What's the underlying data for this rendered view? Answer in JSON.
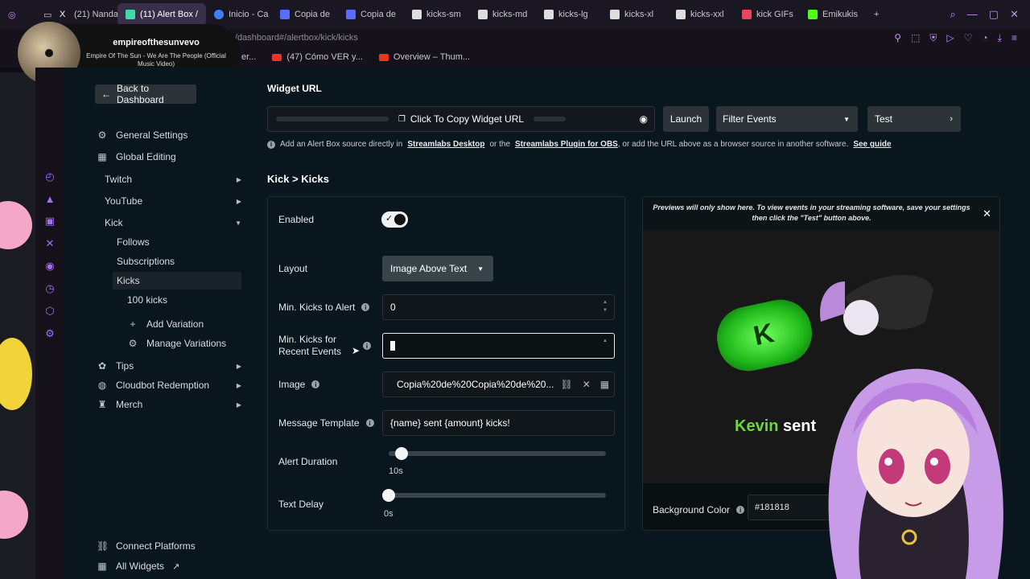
{
  "browser": {
    "tabs": [
      {
        "label": "(21) Nanda",
        "color": "#ffffff"
      },
      {
        "label": "(11) Alert Box /",
        "color": "#40d9a8",
        "active": true
      },
      {
        "label": "Inicio - Ca",
        "color": "#3b82f6"
      },
      {
        "label": "Copia de",
        "color": "#5b6cf5"
      },
      {
        "label": "Copia de",
        "color": "#5b6cf5"
      },
      {
        "label": "kicks-sm",
        "color": "#dddddd"
      },
      {
        "label": "kicks-md",
        "color": "#dddddd"
      },
      {
        "label": "kicks-lg",
        "color": "#dddddd"
      },
      {
        "label": "kicks-xl",
        "color": "#dddddd"
      },
      {
        "label": "kicks-xxl",
        "color": "#dddddd"
      },
      {
        "label": "kick GIFs",
        "color": "#e8475f"
      },
      {
        "label": "Emikukis",
        "color": "#53fc18"
      }
    ],
    "url_fragment": "/dashboard#/alertbox/kick/kicks",
    "bookmarks": [
      "er...",
      "(47) Cómo VER y...",
      "Overview – Thum..."
    ]
  },
  "music": {
    "artist": "empireofthesunvevo",
    "song": "Empire Of The Sun - We Are The People (Official Music Video)"
  },
  "sidebar": {
    "back_label": "Back to Dashboard",
    "general_settings": "General Settings",
    "global_editing": "Global Editing",
    "twitch": "Twitch",
    "youtube": "YouTube",
    "kick": "Kick",
    "follows": "Follows",
    "subscriptions": "Subscriptions",
    "kicks": "Kicks",
    "kicks_100": "100 kicks",
    "add_variation": "Add Variation",
    "manage_variations": "Manage Variations",
    "tips": "Tips",
    "cloudbot": "Cloudbot Redemption",
    "merch": "Merch",
    "connect_platforms": "Connect Platforms",
    "all_widgets": "All Widgets"
  },
  "main": {
    "widget_url_label": "Widget URL",
    "copy_label": "Click To Copy Widget URL",
    "launch": "Launch",
    "filter_events": "Filter Events",
    "test": "Test",
    "info": {
      "prefix": "Add an Alert Box source directly in",
      "desktop": "Streamlabs Desktop",
      "middle": "or the",
      "plugin": "Streamlabs Plugin for OBS",
      "suffix": ", or add the URL above as a browser source in another software.",
      "guide": "See guide"
    },
    "breadcrumb": "Kick > Kicks"
  },
  "settings": {
    "enabled_label": "Enabled",
    "enabled": true,
    "layout_label": "Layout",
    "layout_value": "Image Above Text",
    "min_alert_label": "Min. Kicks to Alert",
    "min_alert_value": "0",
    "min_recent_label_1": "Min. Kicks for",
    "min_recent_label_2": "Recent Events",
    "min_recent_value": "0",
    "image_label": "Image",
    "image_value": "Copia%20de%20Copia%20de%20...",
    "template_label": "Message Template",
    "template_value": "{name} sent {amount} kicks!",
    "duration_label": "Alert Duration",
    "duration_value": "10s",
    "duration_fraction": 0.03,
    "delay_label": "Text Delay",
    "delay_value": "0s",
    "delay_fraction": 0.0
  },
  "preview": {
    "note": "Previews will only show here. To view events in your streaming software, save your settings then click the \"Test\" button above.",
    "name": "Kevin",
    "text": " sent",
    "bg_label": "Background Color",
    "bg_value": "#181818"
  },
  "colors": {
    "accent_green": "#53fc18",
    "panel_bg": "#09161d",
    "preview_bg": "#181818"
  }
}
